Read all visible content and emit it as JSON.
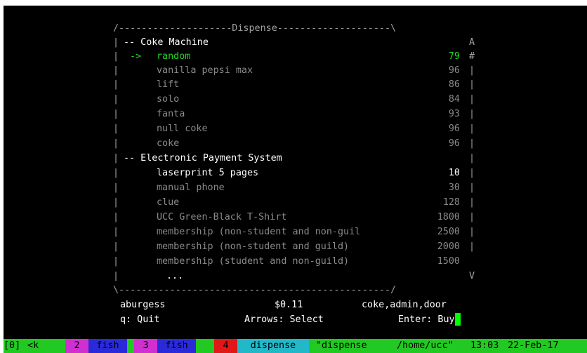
{
  "colors": {
    "background": "#000000",
    "selected": "#22d622",
    "enabled_item": "#ffffff",
    "disabled_item": "#8a8a8a",
    "status_bar": "#22c922",
    "status_magenta": "#d030d0",
    "status_blue": "#2a2ad8",
    "status_red": "#e01818",
    "status_cyan": "#22b8c8"
  },
  "dialog": {
    "top_border": "/--------------------Dispense--------------------\\",
    "bottom_border": "\\------------------------------------------------/",
    "scroll_up": "A",
    "scroll_thumb": "#",
    "scroll_track": "|",
    "scroll_down": "V",
    "left_border": "|"
  },
  "sections": [
    {
      "header": "-- Coke Machine"
    },
    {
      "header": "-- Electronic Payment System"
    }
  ],
  "selector_arrow": "->",
  "items": {
    "coke_machine": [
      {
        "name": "random",
        "price": "79"
      },
      {
        "name": "vanilla pepsi max",
        "price": "96"
      },
      {
        "name": "lift",
        "price": "86"
      },
      {
        "name": "solo",
        "price": "84"
      },
      {
        "name": "fanta",
        "price": "93"
      },
      {
        "name": "null coke",
        "price": "96"
      },
      {
        "name": "coke",
        "price": "96"
      }
    ],
    "eps": [
      {
        "name": "laserprint 5 pages",
        "price": "10"
      },
      {
        "name": "manual phone",
        "price": "30"
      },
      {
        "name": "clue",
        "price": "128"
      },
      {
        "name": "UCC Green-Black T-Shirt",
        "price": "1800"
      },
      {
        "name": "membership (non-student and non-guil",
        "price": "2500"
      },
      {
        "name": "membership (non-student and guild)",
        "price": "2000"
      },
      {
        "name": "membership (student and non-guild)",
        "price": "1500"
      }
    ],
    "more": "..."
  },
  "footer": {
    "user": "aburgess",
    "balance": "$0.11",
    "groups": "coke,admin,door",
    "quit_hint": "q: Quit",
    "select_hint": "Arrows: Select",
    "buy_hint": "Enter: Buy"
  },
  "tmux": {
    "session": "[0]",
    "win0_name": "<k",
    "win2_index": "2",
    "win2_name": "fish",
    "win3_index": "3",
    "win3_name": "fish",
    "win4_index": "4",
    "win4_name": "dispense",
    "pane_title": "\"dispense",
    "path": "/home/ucc\"",
    "time": "13:03",
    "date": "22-Feb-17"
  }
}
